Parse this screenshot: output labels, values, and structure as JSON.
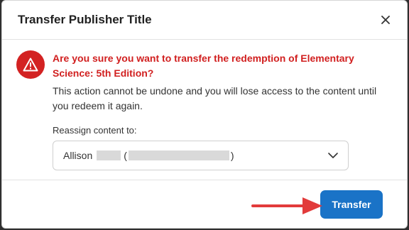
{
  "dialog": {
    "title": "Transfer Publisher Title",
    "headline": "Are you sure you want to transfer the redemption of Elementary Science: 5th Edition?",
    "description": "This action cannot be undone and you will lose access to the content until you redeem it again.",
    "reassign_label": "Reassign content to:",
    "select": {
      "first_name": "Allison",
      "paren_open": "(",
      "paren_close": ")"
    },
    "transfer_label": "Transfer"
  },
  "colors": {
    "danger": "#d11f1f",
    "primary": "#1a73c7",
    "annotation_arrow": "#e23b3b"
  },
  "icons": [
    "close-icon",
    "warning-icon",
    "chevron-down-icon",
    "annotation-arrow"
  ]
}
